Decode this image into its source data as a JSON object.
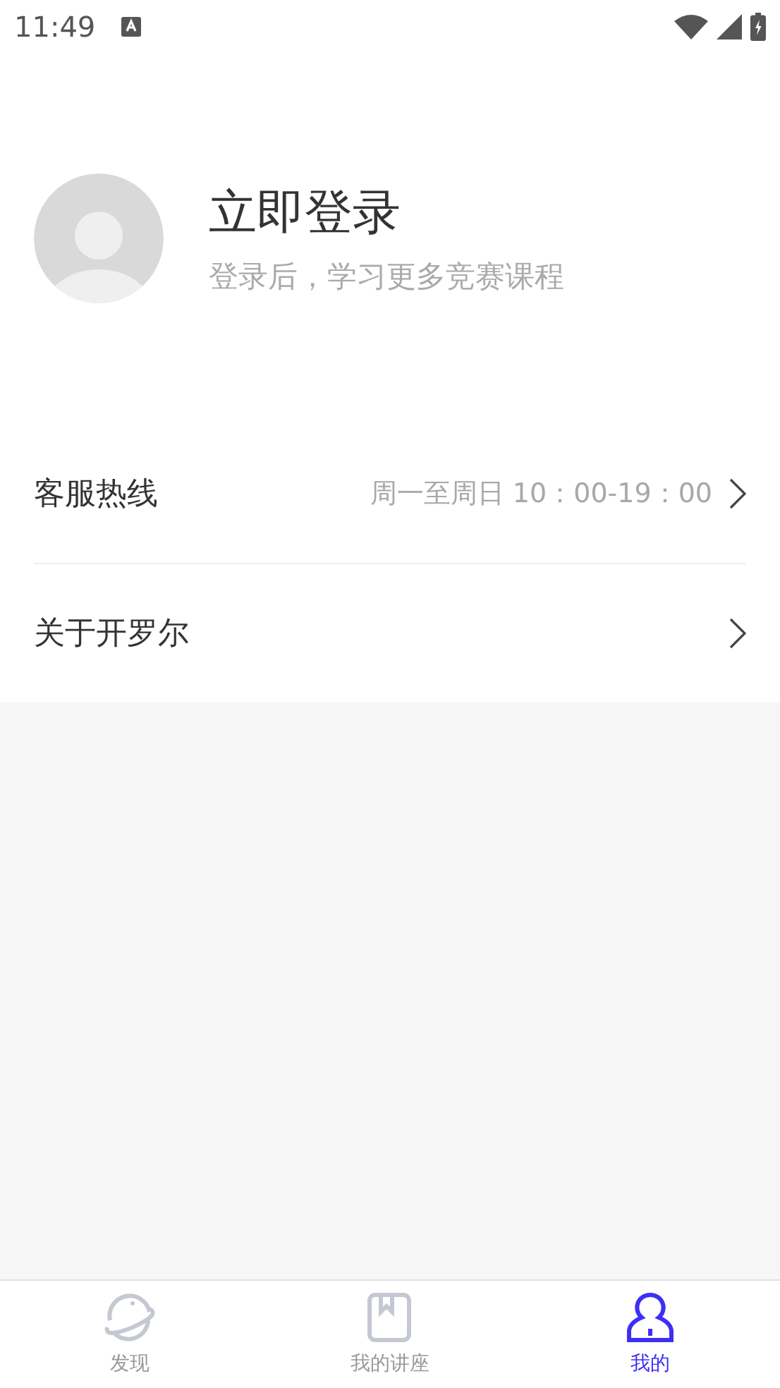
{
  "status_bar": {
    "time": "11:49"
  },
  "profile": {
    "title": "立即登录",
    "subtitle": "登录后，学习更多竞赛课程"
  },
  "menu": [
    {
      "label": "客服热线",
      "value": "周一至周日 10：00-19：00"
    },
    {
      "label": "关于开罗尔"
    }
  ],
  "tabs": [
    {
      "label": "发现",
      "kind": "planet",
      "selected": false
    },
    {
      "label": "我的讲座",
      "kind": "book",
      "selected": false
    },
    {
      "label": "我的",
      "kind": "person",
      "selected": true
    }
  ]
}
